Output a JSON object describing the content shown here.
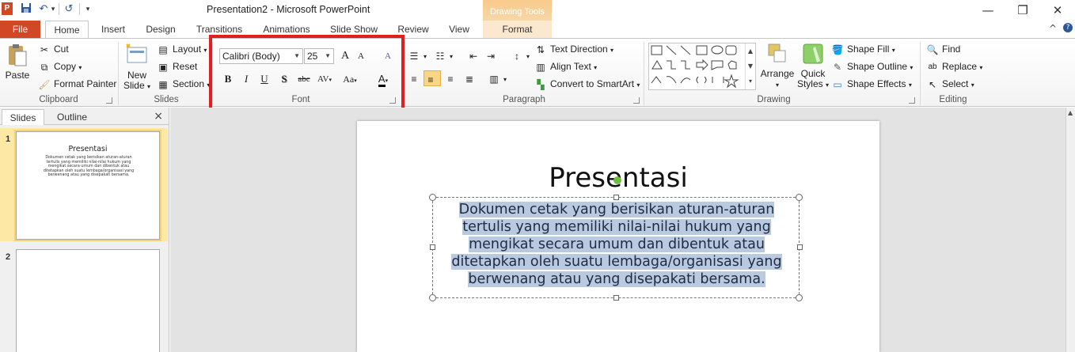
{
  "window": {
    "title": "Presentation2  -  Microsoft PowerPoint",
    "app_icon": "P",
    "contextual_header": "Drawing Tools",
    "controls": {
      "minimize": "—",
      "restore": "❐",
      "close": "✕"
    }
  },
  "quick_access": {
    "save": "💾",
    "undo": "↶",
    "undo_menu": "▾",
    "redo": "↺",
    "customize": "▾"
  },
  "tabs": {
    "file": "File",
    "items": [
      "Home",
      "Insert",
      "Design",
      "Transitions",
      "Animations",
      "Slide Show",
      "Review",
      "View",
      "Format"
    ],
    "active": "Home",
    "help_icon": "?",
    "collapse_icon": "^"
  },
  "ribbon": {
    "clipboard": {
      "label": "Clipboard",
      "paste": "Paste",
      "cut": "Cut",
      "copy": "Copy",
      "format_painter": "Format Painter"
    },
    "slides": {
      "label": "Slides",
      "new_slide_line1": "New",
      "new_slide_line2": "Slide",
      "layout": "Layout",
      "reset": "Reset",
      "section": "Section"
    },
    "font": {
      "label": "Font",
      "font_name": "Calibri (Body)",
      "font_size": "25",
      "grow": "A",
      "shrink": "A",
      "clear": "A",
      "bold": "B",
      "italic": "I",
      "underline": "U",
      "shadow": "S",
      "strikethrough": "abc",
      "spacing": "AV",
      "change_case": "Aa",
      "font_color": "A"
    },
    "paragraph": {
      "label": "Paragraph",
      "text_direction": "Text Direction",
      "align_text": "Align Text",
      "convert_smartart": "Convert to SmartArt"
    },
    "drawing": {
      "label": "Drawing",
      "arrange": "Arrange",
      "quick_styles_line1": "Quick",
      "quick_styles_line2": "Styles",
      "shape_fill": "Shape Fill",
      "shape_outline": "Shape Outline",
      "shape_effects": "Shape Effects"
    },
    "editing": {
      "label": "Editing",
      "find": "Find",
      "replace": "Replace",
      "select": "Select"
    }
  },
  "left_pane": {
    "tabs": [
      "Slides",
      "Outline"
    ],
    "close": "×",
    "slides": [
      {
        "number": "1",
        "title": "Presentasi",
        "body": "Dokumen cetak yang berisikan  aturan-aturan tertulis yang memiliki  nilai-nilai  hukum yang mengikat secara umum dan dibentuk atau ditetapkan oleh suatu lembaga/organisasi  yang berwenang  atau yang disepakati  bersama."
      },
      {
        "number": "2",
        "title": "",
        "body": ""
      }
    ]
  },
  "slide": {
    "title": "Presentasi",
    "body_lines": [
      "Dokumen cetak yang berisikan  aturan-aturan",
      "tertulis yang memiliki  nilai-nilai  hukum yang",
      "mengikat secara umum dan dibentuk atau",
      "ditetapkan oleh suatu lembaga/organisasi yang",
      "berwenang atau yang disepakati bersama."
    ]
  },
  "colors": {
    "accent": "#d24726",
    "highlight_box": "#e02020",
    "selection": "#b9c9e0",
    "contextual": "#f8c98a"
  }
}
